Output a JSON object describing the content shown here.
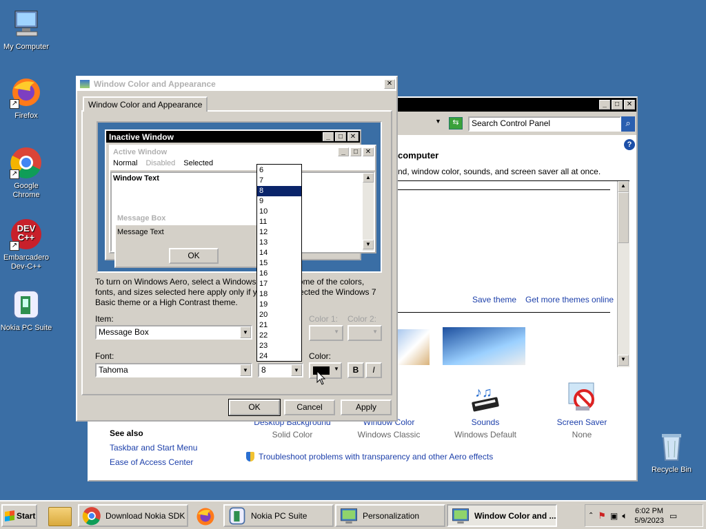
{
  "desktop": {
    "icons": [
      {
        "label": "My Computer",
        "icon": "computer-icon"
      },
      {
        "label": "Firefox",
        "icon": "firefox-icon"
      },
      {
        "label": "Google Chrome",
        "icon": "chrome-icon"
      },
      {
        "label": "Embarcadero Dev-C++",
        "icon": "devcpp-icon",
        "badge": "DEV C++"
      },
      {
        "label": "Nokia PC Suite",
        "icon": "nokia-icon"
      },
      {
        "label": "Recycle Bin",
        "icon": "recycle-bin-icon"
      }
    ]
  },
  "personalization": {
    "search_placeholder": "Search Control Panel",
    "heading": "computer",
    "description": "nd, window color, sounds, and screen saver all at once.",
    "save_theme": "Save theme",
    "get_more": "Get more themes online",
    "tiles": [
      {
        "label": "Desktop Background",
        "sub": "Solid Color"
      },
      {
        "label": "Window Color",
        "sub": "Windows Classic"
      },
      {
        "label": "Sounds",
        "sub": "Windows Default"
      },
      {
        "label": "Screen Saver",
        "sub": "None"
      }
    ],
    "see_also": "See also",
    "links": [
      "Taskbar and Start Menu",
      "Ease of Access Center"
    ],
    "troubleshoot": "Troubleshoot problems with transparency and other Aero effects"
  },
  "dialog": {
    "title": "Window Color and Appearance",
    "tab": "Window Color and Appearance",
    "preview": {
      "inactive": "Inactive Window",
      "active": "Active Window",
      "menu": [
        "Normal",
        "Disabled",
        "Selected"
      ],
      "window_text": "Window Text",
      "msgbox_title": "Message Box",
      "msgbox_text": "Message Text",
      "ok": "OK"
    },
    "info": "To turn on Windows Aero, select a Windows 7 theme. Some of the colors, fonts, and sizes selected here apply only if you have selected the Windows 7 Basic theme or a High Contrast theme.",
    "item_label": "Item:",
    "item_value": "Message Box",
    "color1_label": "Color 1:",
    "color2_label": "Color 2:",
    "font_label": "Font:",
    "font_value": "Tahoma",
    "size_value": "8",
    "color_label": "Color:",
    "bold": "B",
    "italic": "I",
    "size_options": [
      "6",
      "7",
      "8",
      "9",
      "10",
      "11",
      "12",
      "13",
      "14",
      "15",
      "16",
      "17",
      "18",
      "19",
      "20",
      "21",
      "22",
      "23",
      "24"
    ],
    "selected_size": "8",
    "ok": "OK",
    "cancel": "Cancel",
    "apply": "Apply"
  },
  "taskbar": {
    "start": "Start",
    "buttons": [
      {
        "label": "Download Nokia SDK ...",
        "icon": "chrome-icon",
        "active": false
      },
      {
        "label": "Nokia PC Suite",
        "icon": "nokia-icon",
        "active": false
      },
      {
        "label": "Personalization",
        "icon": "personalization-icon",
        "active": false
      },
      {
        "label": "Window Color and ...",
        "icon": "personalization-icon",
        "active": true
      }
    ],
    "time": "6:02 PM",
    "date": "5/9/2023"
  },
  "colors": {
    "desktop": "#3a6ea5",
    "selection": "#0a246a",
    "link": "#1c3faa"
  }
}
